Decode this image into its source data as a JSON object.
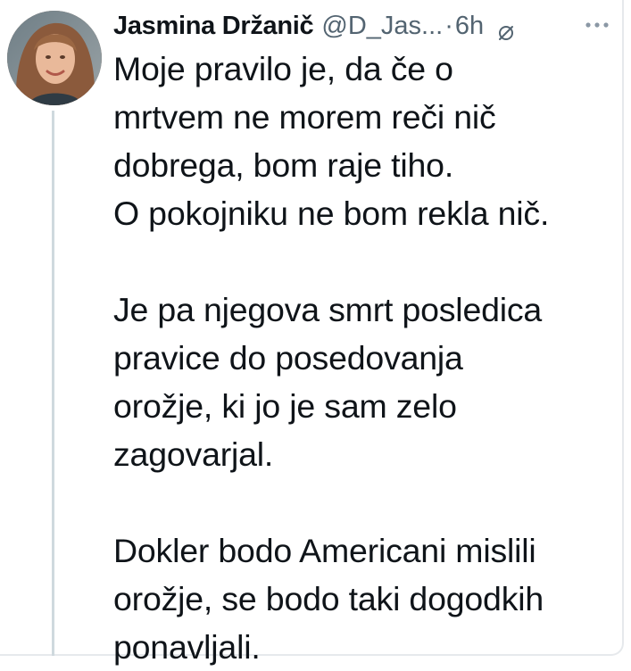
{
  "tweet": {
    "author_name": "Jasmina Držanič",
    "handle": "@D_Jas...",
    "separator": "·",
    "time": "6h",
    "icons": {
      "edited": "edit-indicator-icon",
      "more": "more-options-icon"
    },
    "paragraphs": [
      {
        "lines": [
          "Moje pravilo je, da če o",
          "mrtvem ne morem reči nič",
          "dobrega, bom raje tiho.",
          "O pokojniku ne bom rekla nič."
        ]
      },
      {
        "lines": [
          "Je pa njegova smrt posledica",
          "pravice do posedovanja",
          "orožje, ki jo je sam zelo",
          "zagovarjal."
        ]
      },
      {
        "lines": [
          "Dokler bodo Americani mislili",
          "orožje, se bodo taki dogodkih",
          "ponavljali."
        ]
      }
    ]
  }
}
